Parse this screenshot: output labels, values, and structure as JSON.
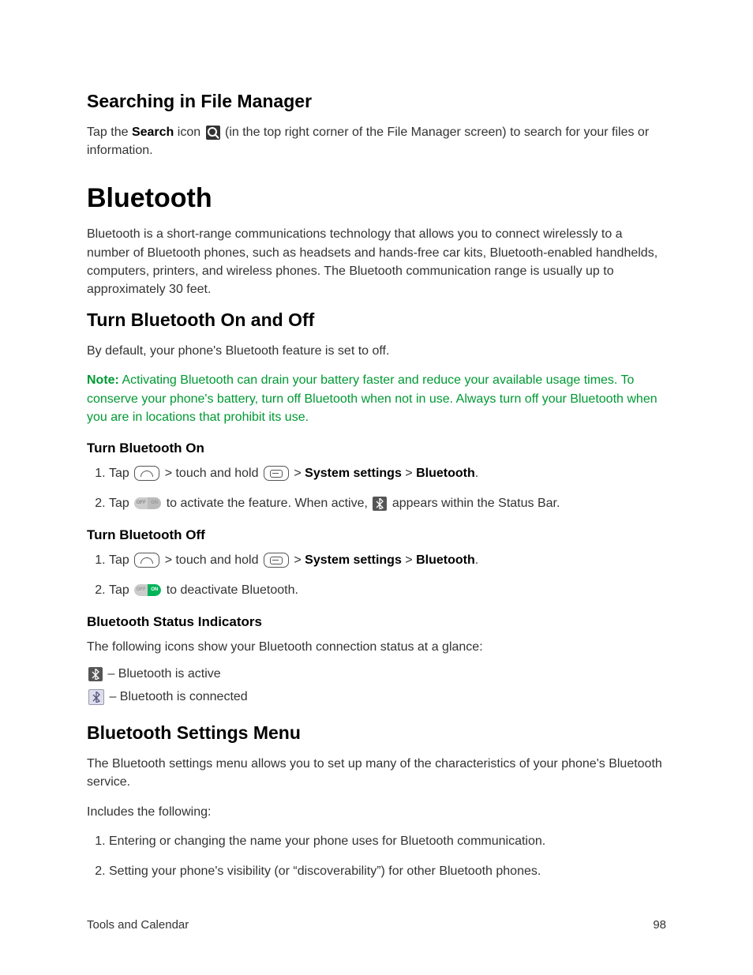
{
  "section1": {
    "heading": "Searching in File Manager",
    "p1a": "Tap the ",
    "p1b": "Search",
    "p1c": " icon ",
    "p1d": " (in the top right corner of the File Manager screen) to search for your files or information."
  },
  "chapter": {
    "heading": "Bluetooth",
    "intro": "Bluetooth is a short-range communications technology that allows you to connect wirelessly to a number of Bluetooth phones, such as headsets and hands-free car kits, Bluetooth-enabled handhelds, computers, printers, and wireless phones. The Bluetooth communication range is usually up to approximately 30 feet."
  },
  "turn": {
    "heading": "Turn Bluetooth On and Off",
    "default": "By default, your phone's Bluetooth feature is set to off.",
    "note_label": "Note:",
    "note_body": " Activating Bluetooth can drain your battery faster and reduce your available usage times. To conserve your phone's battery, turn off Bluetooth when not in use. Always turn off your Bluetooth when you are in locations that prohibit its use.",
    "on_heading": "Turn Bluetooth On",
    "on_step1_a": "Tap ",
    "on_step1_b": " > touch and hold ",
    "on_step1_c": " > ",
    "on_step1_d": "System settings",
    "on_step1_e": " > ",
    "on_step1_f": "Bluetooth",
    "on_step1_g": ".",
    "on_step2_a": "Tap ",
    "on_step2_b": " to activate the feature. When active, ",
    "on_step2_c": " appears within the Status Bar.",
    "off_heading": "Turn Bluetooth Off",
    "off_step1_a": "Tap ",
    "off_step1_b": " > touch and hold ",
    "off_step1_c": " > ",
    "off_step1_d": "System settings",
    "off_step1_e": " > ",
    "off_step1_f": "Bluetooth",
    "off_step1_g": ".",
    "off_step2_a": "Tap ",
    "off_step2_b": " to deactivate Bluetooth.",
    "status_heading": "Bluetooth Status Indicators",
    "status_intro": "The following icons show your Bluetooth connection status at a glance:",
    "status_active": " – Bluetooth is active",
    "status_connected": " – Bluetooth is connected"
  },
  "settings": {
    "heading": "Bluetooth Settings Menu",
    "intro": "The Bluetooth settings menu allows you to set up many of the characteristics of your phone's Bluetooth service.",
    "includes": "Includes the following:",
    "item1": "Entering or changing the name your phone uses for Bluetooth communication.",
    "item2": "Setting your phone's visibility (or “discoverability”) for other Bluetooth phones."
  },
  "toggle": {
    "off": "OFF",
    "on": "ON"
  },
  "footer": {
    "section": "Tools and Calendar",
    "page": "98"
  }
}
